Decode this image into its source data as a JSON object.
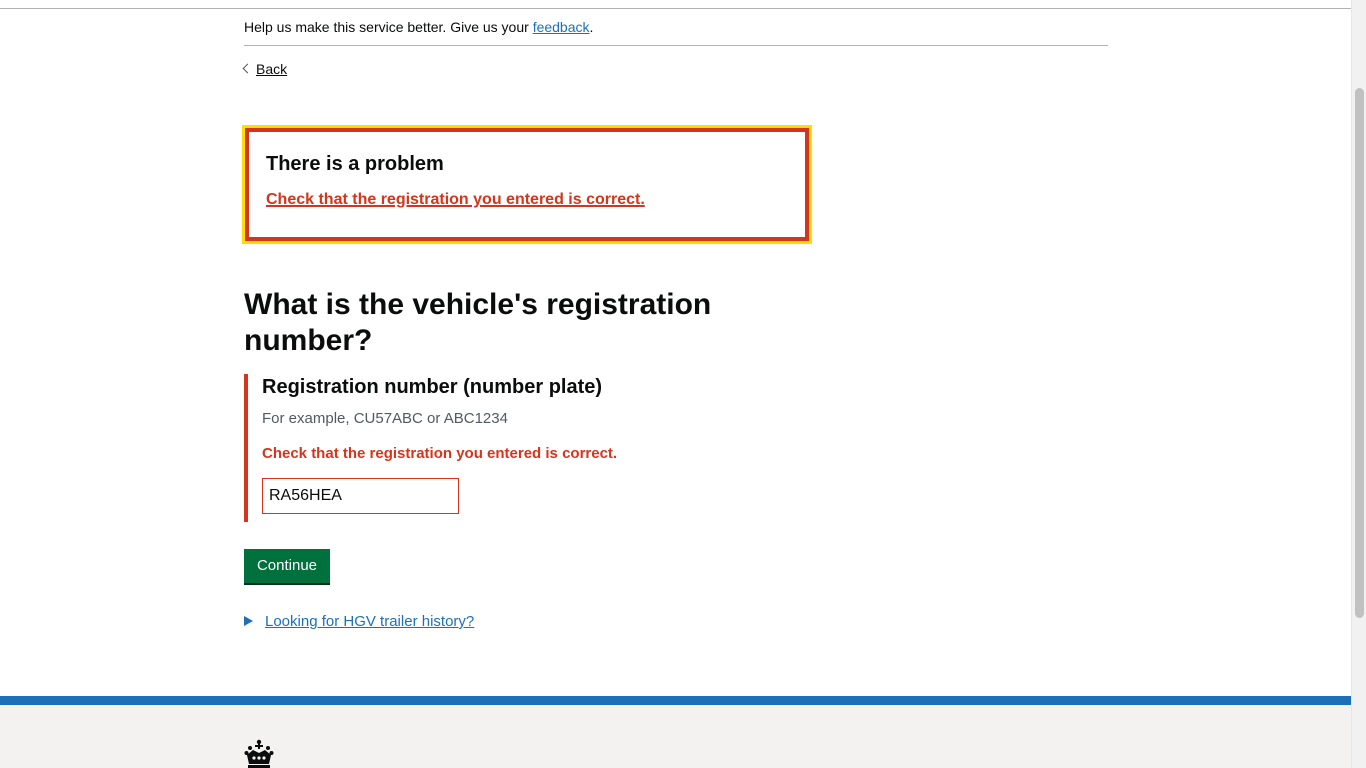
{
  "phase_banner": {
    "text": "Help us make this service better. Give us your",
    "link": "feedback",
    "end": "."
  },
  "back_link": "Back",
  "error_summary": {
    "title": "There is a problem",
    "error_link": "Check that the registration you entered is correct."
  },
  "page_title": "What is the vehicle's registration number?",
  "field": {
    "label": "Registration number (number plate)",
    "hint": "For example, CU57ABC or ABC1234",
    "error": "Check that the registration you entered is correct.",
    "value": "RA56HEA"
  },
  "continue_button": "Continue",
  "details_summary": "Looking for HGV trailer history?",
  "colors": {
    "error": "#d4351c",
    "focus": "#ffdd00",
    "link": "#1d70b8",
    "button": "#00703c",
    "footer_bar": "#1d70b8"
  },
  "icons": [
    "back-chevron-icon",
    "expand-triangle-icon",
    "crown-icon"
  ]
}
